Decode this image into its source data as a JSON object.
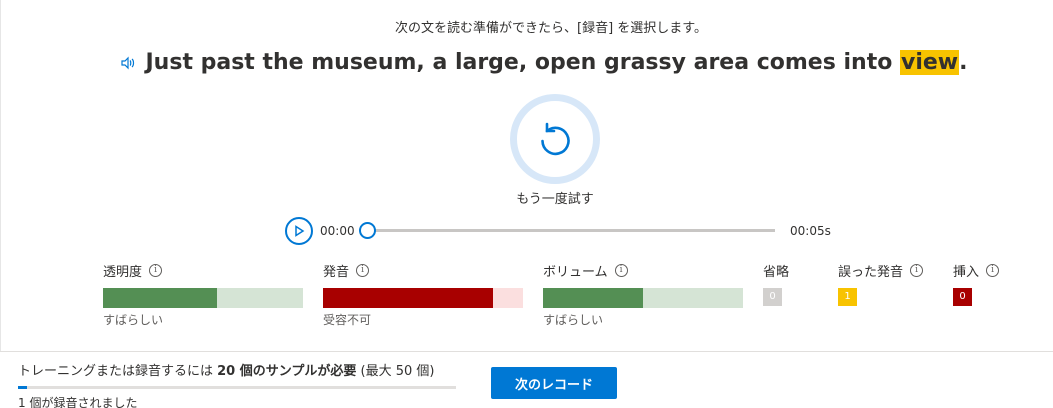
{
  "instruction": "次の文を読む準備ができたら、[録音] を選択します。",
  "sentence": {
    "before": "Just past the museum, a large, open grassy area comes into ",
    "highlighted": "view",
    "after": "."
  },
  "retry": {
    "label": "もう一度試す"
  },
  "player": {
    "current_time": "00:00",
    "duration": "00:05s",
    "progress_fraction": 0
  },
  "metrics": [
    {
      "title": "透明度",
      "caption": "すばらしい",
      "value_fraction": 0.57,
      "fill_color": "#548f54",
      "track_color": "#d5e4d5"
    },
    {
      "title": "発音",
      "caption": "受容不可",
      "value_fraction": 0.85,
      "fill_color": "#a80000",
      "track_color": "#fbdfdf"
    },
    {
      "title": "ボリューム",
      "caption": "すばらしい",
      "value_fraction": 0.5,
      "fill_color": "#548f54",
      "track_color": "#d5e4d5"
    }
  ],
  "counts": [
    {
      "title": "省略",
      "value": "0",
      "color": "#d2d0ce"
    },
    {
      "title": "誤った発音",
      "value": "1",
      "color": "#f8c300"
    },
    {
      "title": "挿入",
      "value": "0",
      "color": "#a80000"
    }
  ],
  "footer": {
    "sample_prefix": "トレーニングまたは録音するには ",
    "sample_bold": "20 個のサンプルが必要",
    "sample_suffix": " (最大 50 個)",
    "progress_fraction": 0.02,
    "recorded_note": "1 個が録音されました",
    "next_button": "次のレコード"
  },
  "colors": {
    "accent": "#0078d4",
    "highlight": "#f8c300"
  }
}
